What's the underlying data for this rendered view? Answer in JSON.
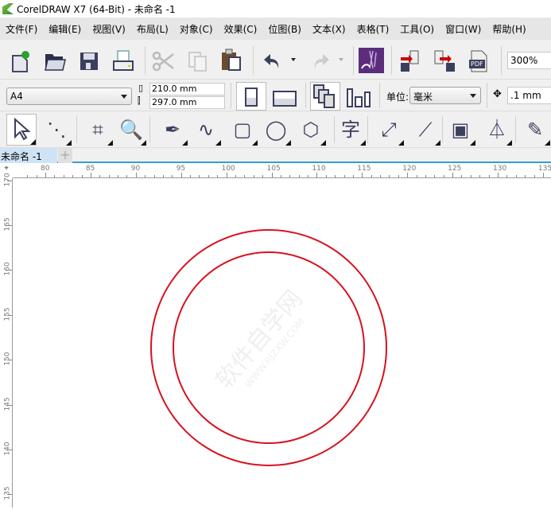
{
  "window": {
    "title": "CorelDRAW X7 (64-Bit) - 未命名 -1"
  },
  "menu": [
    "文件(F)",
    "编辑(E)",
    "视图(V)",
    "布局(L)",
    "对象(C)",
    "效果(C)",
    "位图(B)",
    "文本(X)",
    "表格(T)",
    "工具(O)",
    "窗口(W)",
    "帮助(H)"
  ],
  "toolbar": {
    "zoom": "300%",
    "icons": [
      "new-document-icon",
      "open-folder-icon",
      "save-icon",
      "print-icon",
      "cut-icon",
      "copy-icon",
      "paste-icon",
      "undo-icon",
      "redo-icon",
      "corel-connect-icon",
      "import-icon",
      "export-icon",
      "pdf-export-icon"
    ],
    "pdf_label": "PDF"
  },
  "property_bar": {
    "page_size": "A4",
    "width": "210.0 mm",
    "height": "297.0 mm",
    "units_label": "单位:",
    "units": "毫米",
    "nudge": ".1 mm"
  },
  "toolbox": [
    "pick-tool-icon",
    "shape-tool-icon",
    "crop-tool-icon",
    "zoom-tool-icon",
    "pen-tool-icon",
    "artistic-media-icon",
    "rectangle-tool-icon",
    "ellipse-tool-icon",
    "polygon-tool-icon",
    "text-tool-icon",
    "dimension-tool-icon",
    "connector-tool-icon",
    "drop-shadow-tool-icon",
    "transparency-tool-icon",
    "eyedropper-tool-icon"
  ],
  "toolbox_text_glyph": "字",
  "tabs": [
    {
      "label": "未命名 -1",
      "active": true
    }
  ],
  "tab_add": "+",
  "rulers": {
    "horizontal": [
      80,
      85,
      90,
      95,
      100,
      105,
      110,
      115,
      120,
      125,
      130,
      135
    ],
    "vertical": [
      170,
      165,
      160,
      155,
      150,
      145,
      140,
      135
    ]
  },
  "watermark": "软件自学网 WWW.RJZXW.COM",
  "colors": {
    "circle_stroke": "#d7121f",
    "accent": "#3a9ad9"
  }
}
